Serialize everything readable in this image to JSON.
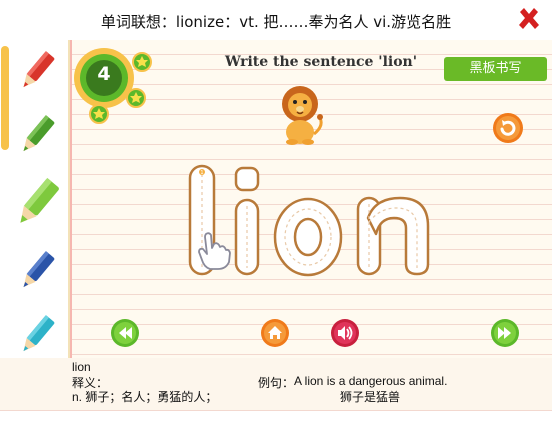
{
  "header": {
    "title": "单词联想：lionize：vt. 把……奉为名人 vi.游览名胜",
    "close_icon": "close-icon"
  },
  "sidebar": {
    "pencils": [
      {
        "name": "red",
        "color": "#d8352b"
      },
      {
        "name": "green-dark",
        "color": "#4a9c2b"
      },
      {
        "name": "green-light",
        "color": "#7ec93d"
      },
      {
        "name": "blue",
        "color": "#2b54a8"
      },
      {
        "name": "cyan",
        "color": "#2db2c8"
      }
    ]
  },
  "game": {
    "stars_count": "4",
    "prompt": "Write the sentence 'lion'",
    "chalkboard_button": "黑板书写",
    "trace_word": "lion"
  },
  "controls": {
    "prev": "previous-icon",
    "home": "home-icon",
    "sound": "sound-icon",
    "next": "next-icon",
    "refresh": "refresh-icon"
  },
  "word_info": {
    "word": "lion",
    "meaning_label": "释义：",
    "meaning": "n. 狮子；名人；勇猛的人；",
    "example_label": "例句：",
    "example_en": "A lion is a dangerous animal.",
    "example_cn": "狮子是猛兽"
  },
  "colors": {
    "accent_green": "#6aba27",
    "orange": "#f07a1a",
    "pink": "#e0345a",
    "trace_brown": "#b87a3a"
  }
}
